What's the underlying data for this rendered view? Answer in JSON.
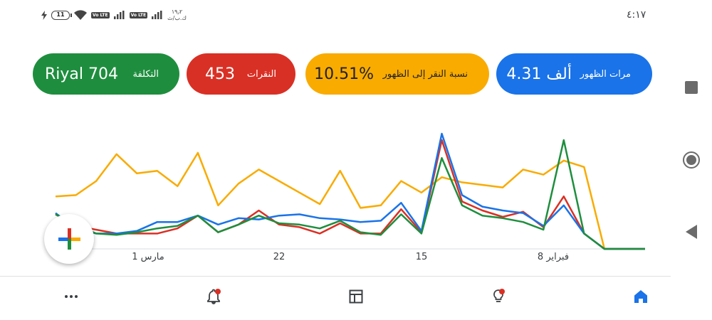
{
  "status_bar": {
    "time": "٤:١٧",
    "battery": "11",
    "network_speed_value": "١٩٫٢",
    "network_speed_unit": "ك.ب/ث",
    "lte_badge": "Vo LTE"
  },
  "metrics": {
    "impressions": {
      "label": "مرات الظهور",
      "value": "4.31 ألف",
      "color": "#1a73e8"
    },
    "ctr": {
      "label": "نسبة النقر إلى الظهور",
      "value": "10.51%",
      "color": "#f9ab00"
    },
    "clicks": {
      "label": "النقرات",
      "value": "453",
      "color": "#d93025"
    },
    "cost": {
      "label": "التكلفة",
      "value": "Riyal 704",
      "color": "#1e8e3e"
    }
  },
  "chart_data": {
    "type": "line",
    "x_tick_labels": [
      "مارس 1",
      "22",
      "15",
      "فبراير 8"
    ],
    "grid": false,
    "series": [
      {
        "name": "نسبة النقر إلى الظهور",
        "color": "#f9ab00",
        "values": [
          0.41,
          0.42,
          0.53,
          0.74,
          0.59,
          0.61,
          0.49,
          0.75,
          0.34,
          0.51,
          0.62,
          0.53,
          0.44,
          0.35,
          0.61,
          0.32,
          0.34,
          0.53,
          0.44,
          0.56,
          0.52,
          0.5,
          0.48,
          0.62,
          0.58,
          0.69,
          0.64,
          0.0,
          0.0,
          0.0
        ]
      },
      {
        "name": "النقرات",
        "color": "#d93025",
        "values": [
          0.27,
          0.18,
          0.15,
          0.12,
          0.12,
          0.12,
          0.16,
          0.26,
          0.13,
          0.19,
          0.3,
          0.19,
          0.17,
          0.12,
          0.2,
          0.12,
          0.12,
          0.31,
          0.13,
          0.85,
          0.37,
          0.3,
          0.25,
          0.29,
          0.17,
          0.41,
          0.12,
          0.0,
          0.0,
          0.0
        ]
      },
      {
        "name": "مرات الظهور",
        "color": "#1a73e8",
        "values": [
          0.28,
          0.16,
          0.12,
          0.12,
          0.14,
          0.21,
          0.21,
          0.26,
          0.19,
          0.24,
          0.23,
          0.26,
          0.27,
          0.24,
          0.23,
          0.21,
          0.22,
          0.36,
          0.14,
          0.9,
          0.42,
          0.33,
          0.3,
          0.28,
          0.18,
          0.34,
          0.12,
          0.0,
          0.0,
          0.0
        ]
      },
      {
        "name": "التكلفة",
        "color": "#1e8e3e",
        "values": [
          0.27,
          0.19,
          0.12,
          0.11,
          0.13,
          0.16,
          0.18,
          0.26,
          0.13,
          0.19,
          0.26,
          0.2,
          0.19,
          0.16,
          0.22,
          0.13,
          0.11,
          0.27,
          0.12,
          0.71,
          0.34,
          0.26,
          0.24,
          0.21,
          0.15,
          0.85,
          0.12,
          0.0,
          0.0,
          0.0
        ]
      }
    ]
  },
  "fab": {
    "icon": "plus-icon"
  },
  "bottom_nav": {
    "items": [
      {
        "icon": "more-icon"
      },
      {
        "icon": "notifications-icon",
        "badge": true
      },
      {
        "icon": "campaigns-icon"
      },
      {
        "icon": "recommendations-icon",
        "badge": true
      },
      {
        "icon": "home-icon",
        "active": true
      }
    ]
  },
  "system_nav": [
    "recent-apps-icon",
    "home-circle-icon",
    "back-icon"
  ]
}
